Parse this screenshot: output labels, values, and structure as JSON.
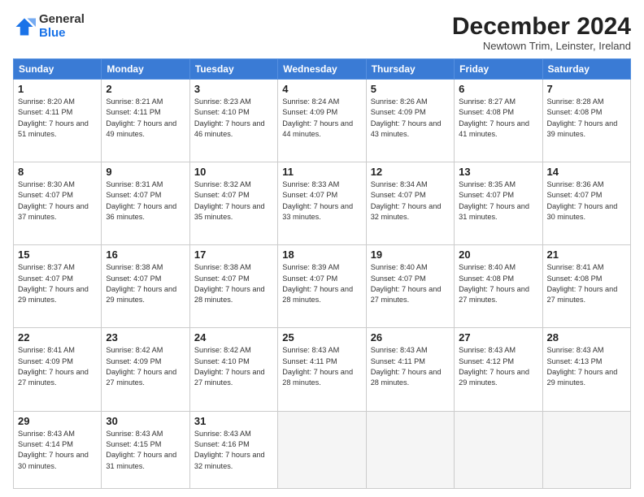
{
  "logo": {
    "general": "General",
    "blue": "Blue"
  },
  "header": {
    "month": "December 2024",
    "location": "Newtown Trim, Leinster, Ireland"
  },
  "days": [
    "Sunday",
    "Monday",
    "Tuesday",
    "Wednesday",
    "Thursday",
    "Friday",
    "Saturday"
  ],
  "weeks": [
    [
      {
        "day": "1",
        "sunrise": "8:20 AM",
        "sunset": "4:11 PM",
        "daylight": "7 hours and 51 minutes."
      },
      {
        "day": "2",
        "sunrise": "8:21 AM",
        "sunset": "4:11 PM",
        "daylight": "7 hours and 49 minutes."
      },
      {
        "day": "3",
        "sunrise": "8:23 AM",
        "sunset": "4:10 PM",
        "daylight": "7 hours and 46 minutes."
      },
      {
        "day": "4",
        "sunrise": "8:24 AM",
        "sunset": "4:09 PM",
        "daylight": "7 hours and 44 minutes."
      },
      {
        "day": "5",
        "sunrise": "8:26 AM",
        "sunset": "4:09 PM",
        "daylight": "7 hours and 43 minutes."
      },
      {
        "day": "6",
        "sunrise": "8:27 AM",
        "sunset": "4:08 PM",
        "daylight": "7 hours and 41 minutes."
      },
      {
        "day": "7",
        "sunrise": "8:28 AM",
        "sunset": "4:08 PM",
        "daylight": "7 hours and 39 minutes."
      }
    ],
    [
      {
        "day": "8",
        "sunrise": "8:30 AM",
        "sunset": "4:07 PM",
        "daylight": "7 hours and 37 minutes."
      },
      {
        "day": "9",
        "sunrise": "8:31 AM",
        "sunset": "4:07 PM",
        "daylight": "7 hours and 36 minutes."
      },
      {
        "day": "10",
        "sunrise": "8:32 AM",
        "sunset": "4:07 PM",
        "daylight": "7 hours and 35 minutes."
      },
      {
        "day": "11",
        "sunrise": "8:33 AM",
        "sunset": "4:07 PM",
        "daylight": "7 hours and 33 minutes."
      },
      {
        "day": "12",
        "sunrise": "8:34 AM",
        "sunset": "4:07 PM",
        "daylight": "7 hours and 32 minutes."
      },
      {
        "day": "13",
        "sunrise": "8:35 AM",
        "sunset": "4:07 PM",
        "daylight": "7 hours and 31 minutes."
      },
      {
        "day": "14",
        "sunrise": "8:36 AM",
        "sunset": "4:07 PM",
        "daylight": "7 hours and 30 minutes."
      }
    ],
    [
      {
        "day": "15",
        "sunrise": "8:37 AM",
        "sunset": "4:07 PM",
        "daylight": "7 hours and 29 minutes."
      },
      {
        "day": "16",
        "sunrise": "8:38 AM",
        "sunset": "4:07 PM",
        "daylight": "7 hours and 29 minutes."
      },
      {
        "day": "17",
        "sunrise": "8:38 AM",
        "sunset": "4:07 PM",
        "daylight": "7 hours and 28 minutes."
      },
      {
        "day": "18",
        "sunrise": "8:39 AM",
        "sunset": "4:07 PM",
        "daylight": "7 hours and 28 minutes."
      },
      {
        "day": "19",
        "sunrise": "8:40 AM",
        "sunset": "4:07 PM",
        "daylight": "7 hours and 27 minutes."
      },
      {
        "day": "20",
        "sunrise": "8:40 AM",
        "sunset": "4:08 PM",
        "daylight": "7 hours and 27 minutes."
      },
      {
        "day": "21",
        "sunrise": "8:41 AM",
        "sunset": "4:08 PM",
        "daylight": "7 hours and 27 minutes."
      }
    ],
    [
      {
        "day": "22",
        "sunrise": "8:41 AM",
        "sunset": "4:09 PM",
        "daylight": "7 hours and 27 minutes."
      },
      {
        "day": "23",
        "sunrise": "8:42 AM",
        "sunset": "4:09 PM",
        "daylight": "7 hours and 27 minutes."
      },
      {
        "day": "24",
        "sunrise": "8:42 AM",
        "sunset": "4:10 PM",
        "daylight": "7 hours and 27 minutes."
      },
      {
        "day": "25",
        "sunrise": "8:43 AM",
        "sunset": "4:11 PM",
        "daylight": "7 hours and 28 minutes."
      },
      {
        "day": "26",
        "sunrise": "8:43 AM",
        "sunset": "4:11 PM",
        "daylight": "7 hours and 28 minutes."
      },
      {
        "day": "27",
        "sunrise": "8:43 AM",
        "sunset": "4:12 PM",
        "daylight": "7 hours and 29 minutes."
      },
      {
        "day": "28",
        "sunrise": "8:43 AM",
        "sunset": "4:13 PM",
        "daylight": "7 hours and 29 minutes."
      }
    ],
    [
      {
        "day": "29",
        "sunrise": "8:43 AM",
        "sunset": "4:14 PM",
        "daylight": "7 hours and 30 minutes."
      },
      {
        "day": "30",
        "sunrise": "8:43 AM",
        "sunset": "4:15 PM",
        "daylight": "7 hours and 31 minutes."
      },
      {
        "day": "31",
        "sunrise": "8:43 AM",
        "sunset": "4:16 PM",
        "daylight": "7 hours and 32 minutes."
      },
      null,
      null,
      null,
      null
    ]
  ]
}
